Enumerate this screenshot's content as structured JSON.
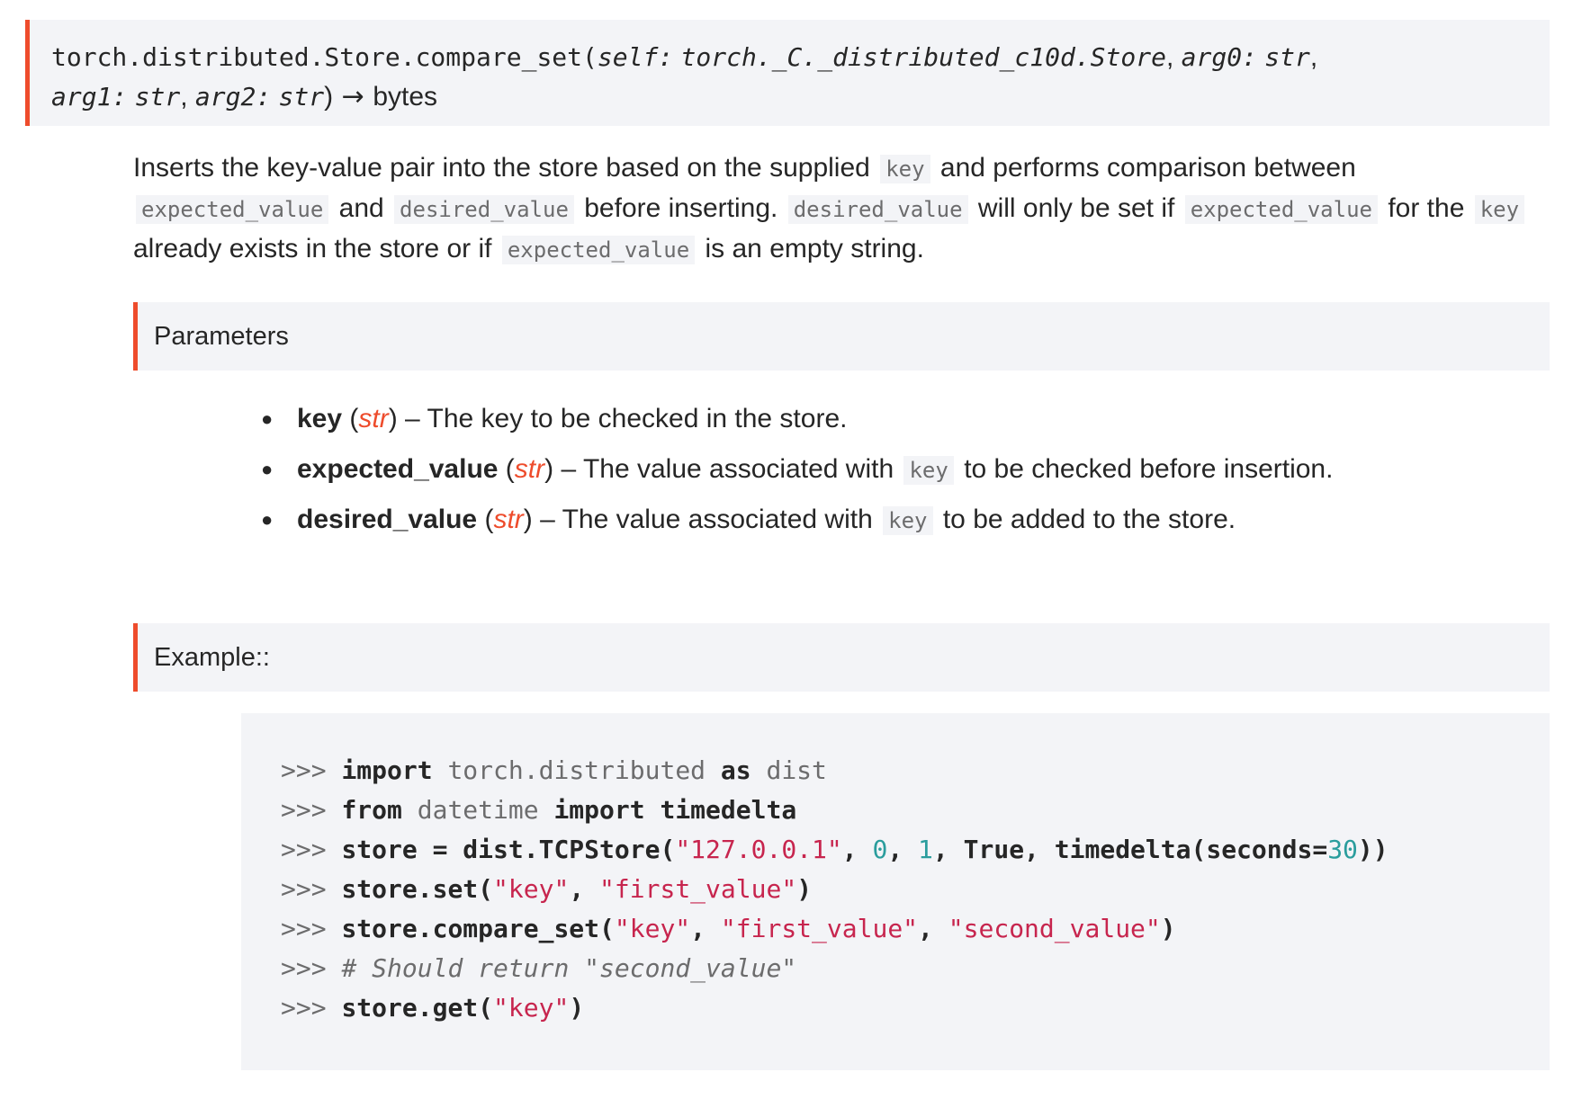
{
  "signature": {
    "name": "torch.distributed.Store.compare_set",
    "open_paren": "(",
    "p_self": "self:",
    "t_self": "torch._C._distributed_c10d.Store",
    "sep1": ", ",
    "p_arg0": "arg0:",
    "t_arg0": "str",
    "sep2": ",",
    "p_arg1": "arg1:",
    "t_arg1": "str",
    "sep3": ", ",
    "p_arg2": "arg2:",
    "t_arg2": "str",
    "close_paren": ")",
    "arrow": " → ",
    "return_type": "bytes"
  },
  "description": {
    "t1": "Inserts the key-value pair into the store based on the supplied",
    "c1": "key",
    "t2": "and performs comparison between",
    "c2": "expected_value",
    "t3": "and",
    "c3": "desired_value",
    "t4": "before inserting.",
    "c4": "desired_value",
    "t5": "will only be set if",
    "c5": "expected_value",
    "t6": "for the",
    "c6": "key",
    "t7": "already exists in the store or if",
    "c7": "expected_value",
    "t8": "is an empty string."
  },
  "parameters": {
    "heading": "Parameters",
    "dash": " – ",
    "items": [
      {
        "name": "key",
        "type": "str",
        "text_before": "The key to be checked in the store.",
        "code": "",
        "text_after": ""
      },
      {
        "name": "expected_value",
        "type": "str",
        "text_before": "The value associated with",
        "code": "key",
        "text_after": "to be checked before insertion."
      },
      {
        "name": "desired_value",
        "type": "str",
        "text_before": "The value associated with",
        "code": "key",
        "text_after": "to be added to the store."
      }
    ]
  },
  "example": {
    "heading": "Example::",
    "prompt": ">>> ",
    "lines": [
      {
        "kw1": "import",
        "mod1": "torch.distributed",
        "kw2": "as",
        "mod2": "dist"
      },
      {
        "kw1": "from",
        "mod1": "datetime",
        "kw2": "import",
        "name": "timedelta"
      },
      {
        "lhs": "store = dist.TCPStore(",
        "s1": "\"127.0.0.1\"",
        "c1": ", ",
        "n1": "0",
        "c2": ", ",
        "n2": "1",
        "c3": ", True, timedelta(seconds=",
        "n3": "30",
        "end": "))"
      },
      {
        "lhs": "store.set(",
        "s1": "\"key\"",
        "c1": ", ",
        "s2": "\"first_value\"",
        "end": ")"
      },
      {
        "lhs": "store.compare_set(",
        "s1": "\"key\"",
        "c1": ", ",
        "s2": "\"first_value\"",
        "c2": ", ",
        "s3": "\"second_value\"",
        "end": ")"
      },
      {
        "comment": "# Should return \"second_value\""
      },
      {
        "lhs": "store.get(",
        "s1": "\"key\"",
        "end": ")"
      }
    ]
  }
}
